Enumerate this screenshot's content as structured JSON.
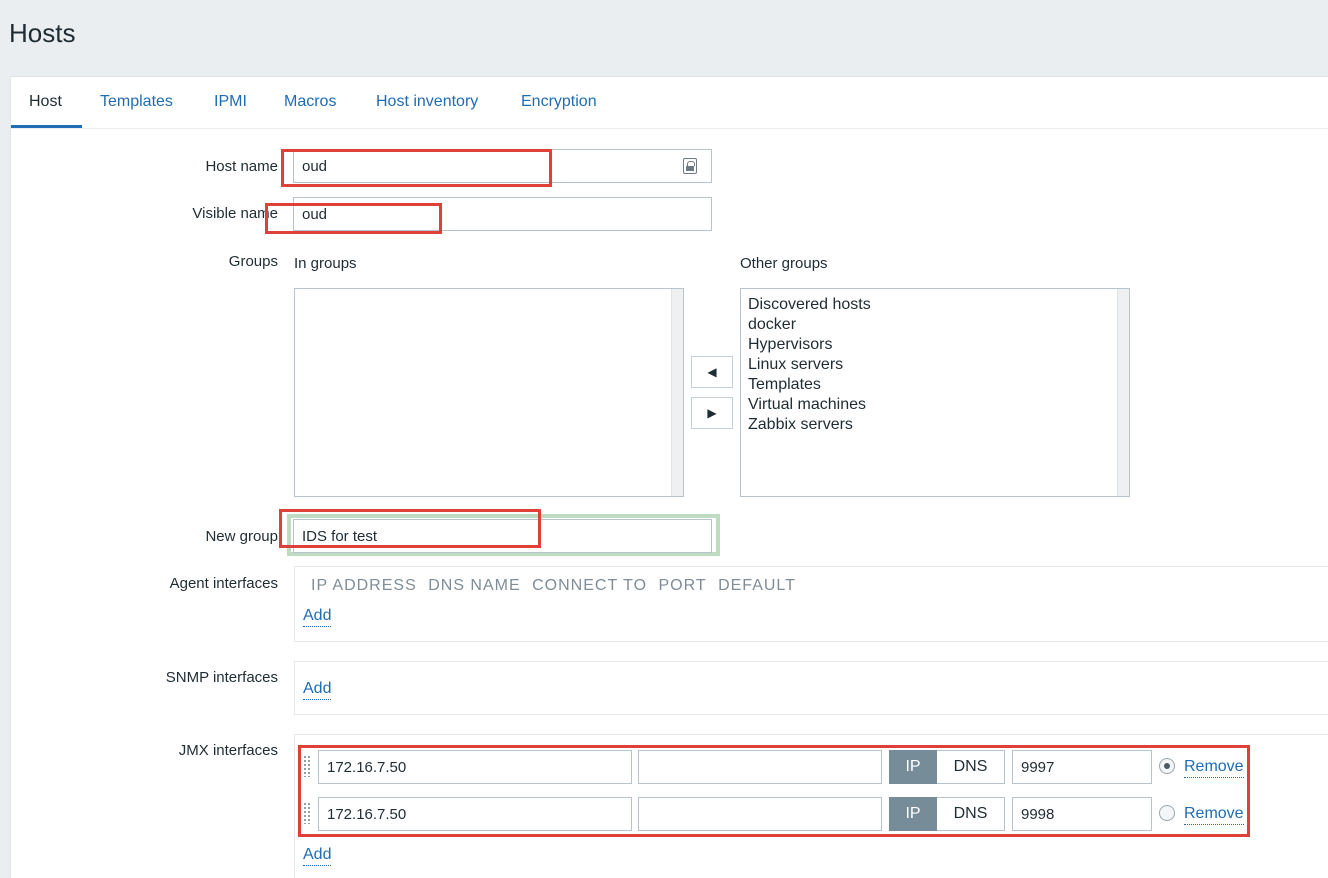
{
  "page": {
    "title": "Hosts"
  },
  "tabs": [
    "Host",
    "Templates",
    "IPMI",
    "Macros",
    "Host inventory",
    "Encryption"
  ],
  "form": {
    "host_name_label": "Host name",
    "host_name_value": "oud",
    "visible_name_label": "Visible name",
    "visible_name_value": "oud",
    "groups_label": "Groups",
    "in_groups_label": "In groups",
    "other_groups_label": "Other groups",
    "other_groups": [
      "Discovered hosts",
      "docker",
      "Hypervisors",
      "Linux servers",
      "Templates",
      "Virtual machines",
      "Zabbix servers"
    ],
    "move_left_symbol": "◀",
    "move_right_symbol": "▶",
    "new_group_label": "New group",
    "new_group_value": "IDS for test",
    "agent_interfaces_label": "Agent interfaces",
    "interface_columns": [
      "IP ADDRESS",
      "DNS NAME",
      "CONNECT TO",
      "PORT",
      "DEFAULT"
    ],
    "add_label": "Add",
    "snmp_interfaces_label": "SNMP interfaces",
    "jmx_interfaces_label": "JMX interfaces",
    "ip_toggle_label": "IP",
    "dns_toggle_label": "DNS",
    "remove_label": "Remove",
    "jmx_interfaces": [
      {
        "ip": "172.16.7.50",
        "dns": "",
        "port": "9997",
        "default": true
      },
      {
        "ip": "172.16.7.50",
        "dns": "",
        "port": "9998",
        "default": false
      }
    ]
  },
  "colors": {
    "link": "#1f6cb4",
    "highlight": "#e0403a",
    "toggle_active": "#768d99"
  }
}
